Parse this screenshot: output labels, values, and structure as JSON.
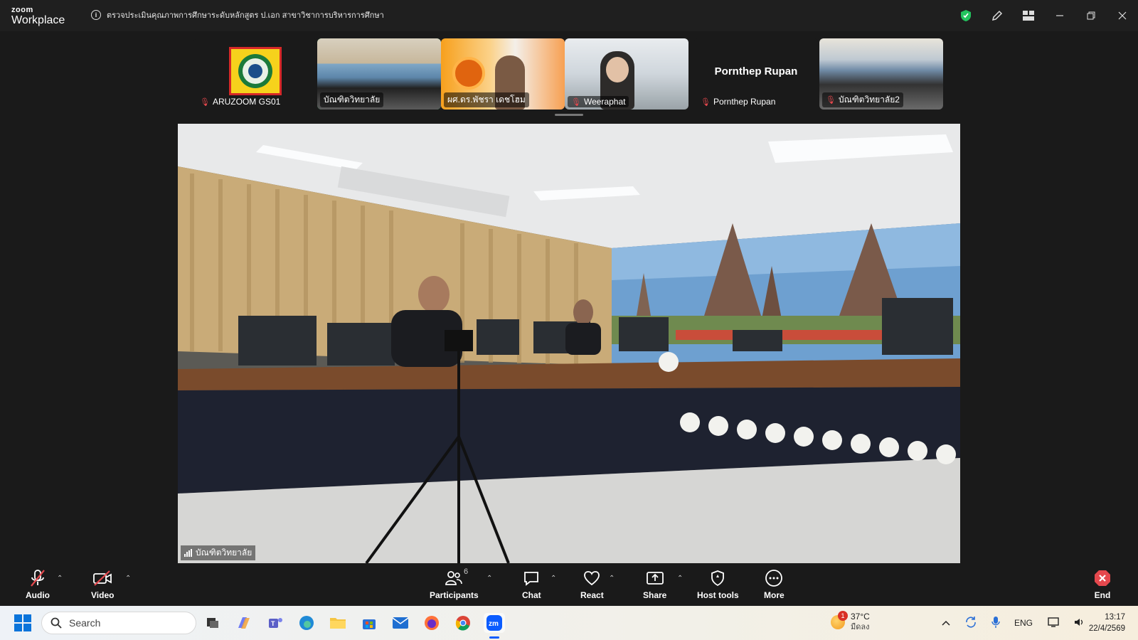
{
  "window": {
    "app_brand_small": "zoom",
    "app_brand_large": "Workplace",
    "meeting_title": "ตรวจประเมินคุณภาพการศึกษาระดับหลักสูตร ป.เอก สาขาวิชาการบริหารการศึกษา"
  },
  "participants": [
    {
      "name": "ARUZOOM GS01",
      "muted": true
    },
    {
      "name": "บัณฑิตวิทยาลัย",
      "muted": false,
      "active": true
    },
    {
      "name": "ผศ.ดร.พัชรา เดชโฮม",
      "muted": false
    },
    {
      "name": "Weeraphat",
      "muted": true
    },
    {
      "name": "Pornthep Rupan",
      "muted": true,
      "display_name": "Pornthep Rupan"
    },
    {
      "name": "บัณฑิตวิทยาลัย2",
      "muted": true
    }
  ],
  "main_video": {
    "speaker_label": "บัณฑิตวิทยาลัย"
  },
  "toolbar": {
    "audio": "Audio",
    "video": "Video",
    "participants": "Participants",
    "participants_count": "6",
    "chat": "Chat",
    "react": "React",
    "share": "Share",
    "host_tools": "Host tools",
    "more": "More",
    "end": "End"
  },
  "taskbar": {
    "search_placeholder": "Search",
    "weather_temp": "37°C",
    "weather_desc": "มืดลง",
    "weather_badge": "1",
    "language": "ENG",
    "time": "13:17",
    "date": "22/4/2569"
  },
  "colors": {
    "active_border": "#2ecc71",
    "muted": "#e5484d",
    "end_red": "#e5484d",
    "shield_green": "#22c55e"
  }
}
